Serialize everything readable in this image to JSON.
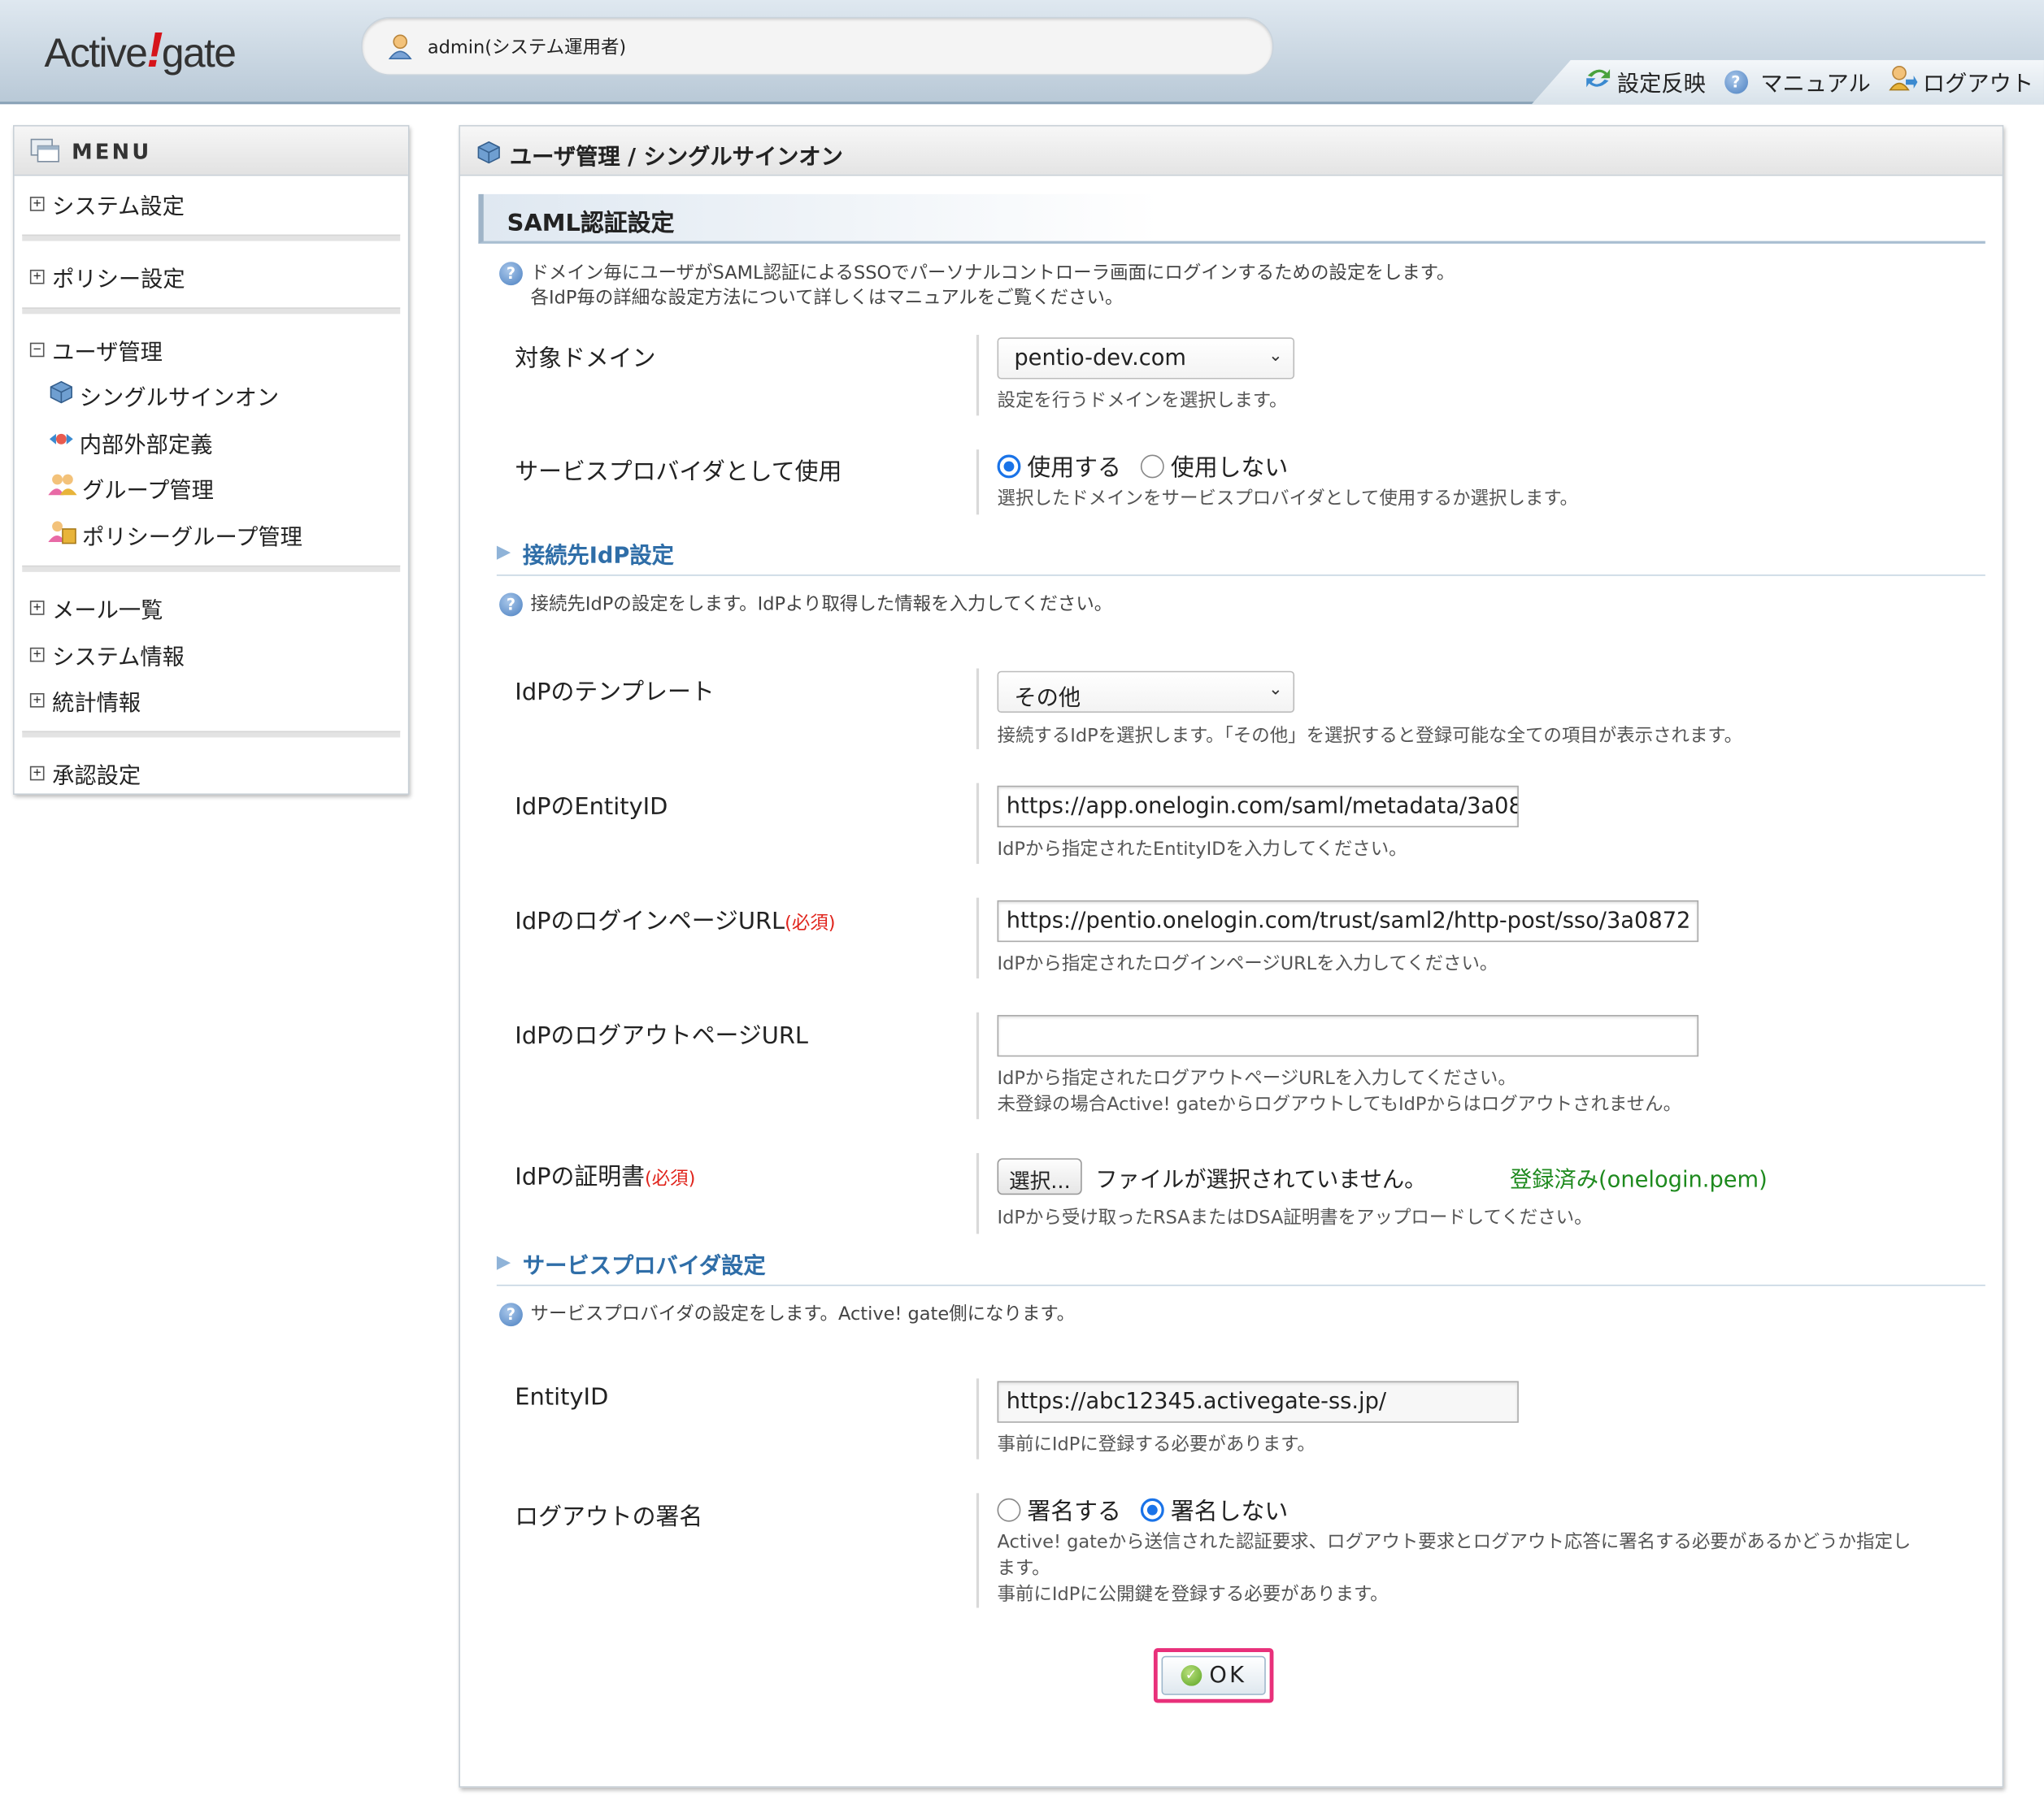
{
  "header": {
    "logo_left": "Active",
    "logo_mark": "!",
    "logo_right": "gate",
    "user": "admin(システム運用者)",
    "links": [
      {
        "label": "設定反映",
        "icon": "reload-arrows-icon"
      },
      {
        "label": "マニュアル",
        "icon": "help-icon"
      },
      {
        "label": "ログアウト",
        "icon": "logout-icon"
      }
    ]
  },
  "sidebar": {
    "title": "MENU",
    "items": [
      {
        "label": "システム設定",
        "toggle": "+"
      },
      {
        "label": "ポリシー設定",
        "toggle": "+"
      },
      {
        "label": "ユーザ管理",
        "toggle": "−"
      },
      {
        "label": "メール一覧",
        "toggle": "+"
      },
      {
        "label": "システム情報",
        "toggle": "+"
      },
      {
        "label": "統計情報",
        "toggle": "+"
      },
      {
        "label": "承認設定",
        "toggle": "+"
      }
    ],
    "subitems": [
      {
        "label": "シングルサインオン"
      },
      {
        "label": "内部外部定義"
      },
      {
        "label": "グループ管理"
      },
      {
        "label": "ポリシーグループ管理"
      }
    ]
  },
  "main": {
    "breadcrumb": "ユーザ管理 / シングルサインオン",
    "section_title": "SAML認証設定",
    "intro_line1": "ドメイン毎にユーザがSAML認証によるSSOでパーソナルコントローラ画面にログインするための設定をします。",
    "intro_line2": "各IdP毎の詳細な設定方法について詳しくはマニュアルをご覧ください。",
    "domain": {
      "label": "対象ドメイン",
      "value": "pentio-dev.com",
      "hint": "設定を行うドメインを選択します。"
    },
    "sp_use": {
      "label": "サービスプロバイダとして使用",
      "option_on": "使用する",
      "option_off": "使用しない",
      "selected": "使用する",
      "hint": "選択したドメインをサービスプロバイダとして使用するか選択します。"
    },
    "idp_section": {
      "title": "接続先IdP設定",
      "note": "接続先IdPの設定をします。IdPより取得した情報を入力してください。"
    },
    "idp_template": {
      "label": "IdPのテンプレート",
      "value": "その他",
      "hint": "接続するIdPを選択します。「その他」を選択すると登録可能な全ての項目が表示されます。"
    },
    "idp_entity": {
      "label": "IdPのEntityID",
      "value": "https://app.onelogin.com/saml/metadata/3a08",
      "hint": "IdPから指定されたEntityIDを入力してください。"
    },
    "idp_login": {
      "label": "IdPのログインページURL",
      "required": "(必須)",
      "value": "https://pentio.onelogin.com/trust/saml2/http-post/sso/3a0872",
      "hint": "IdPから指定されたログインページURLを入力してください。"
    },
    "idp_logout": {
      "label": "IdPのログアウトページURL",
      "value": "",
      "hint1": "IdPから指定されたログアウトページURLを入力してください。",
      "hint2": "未登録の場合Active! gateからログアウトしてもIdPからはログアウトされません。"
    },
    "idp_cert": {
      "label": "IdPの証明書",
      "required": "(必須)",
      "button": "選択...",
      "file_status": "ファイルが選択されていません。",
      "registered": "登録済み(onelogin.pem)",
      "hint": "IdPから受け取ったRSAまたはDSA証明書をアップロードしてください。"
    },
    "sp_section": {
      "title": "サービスプロバイダ設定",
      "note": "サービスプロバイダの設定をします。Active! gate側になります。"
    },
    "sp_entity": {
      "label": "EntityID",
      "value": "https://abc12345.activegate-ss.jp/",
      "hint": "事前にIdPに登録する必要があります。"
    },
    "logout_sign": {
      "label": "ログアウトの署名",
      "option_on": "署名する",
      "option_off": "署名しない",
      "selected": "署名しない",
      "hint1": "Active! gateから送信された認証要求、ログアウト要求とログアウト応答に署名する必要があるかどうか指定し",
      "hint2": "ます。",
      "hint3": "事前にIdPに公開鍵を登録する必要があります。"
    },
    "ok_button": "OK"
  },
  "colors": {
    "accent_link": "#2f6ea8",
    "required": "#e0241c",
    "registered": "#1e8a1e",
    "ok_highlight": "#e8307a",
    "radio_on": "#1a73e8"
  }
}
